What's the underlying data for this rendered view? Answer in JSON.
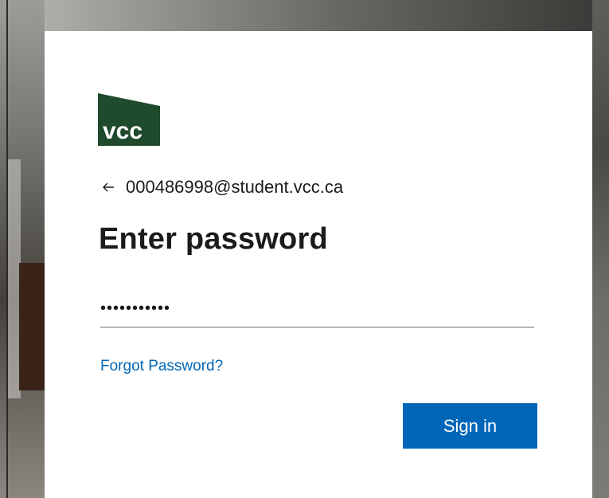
{
  "logo": {
    "text": "vcc",
    "color": "#1f4a2c"
  },
  "identity": {
    "back_icon": "arrow-left-icon",
    "email": "000486998@student.vcc.ca"
  },
  "title": "Enter password",
  "password_field": {
    "value": "•••••••••••"
  },
  "links": {
    "forgot_password": "Forgot Password?"
  },
  "buttons": {
    "sign_in": "Sign in"
  },
  "colors": {
    "accent": "#0067b8",
    "text": "#1b1b1b",
    "card": "#ffffff"
  }
}
